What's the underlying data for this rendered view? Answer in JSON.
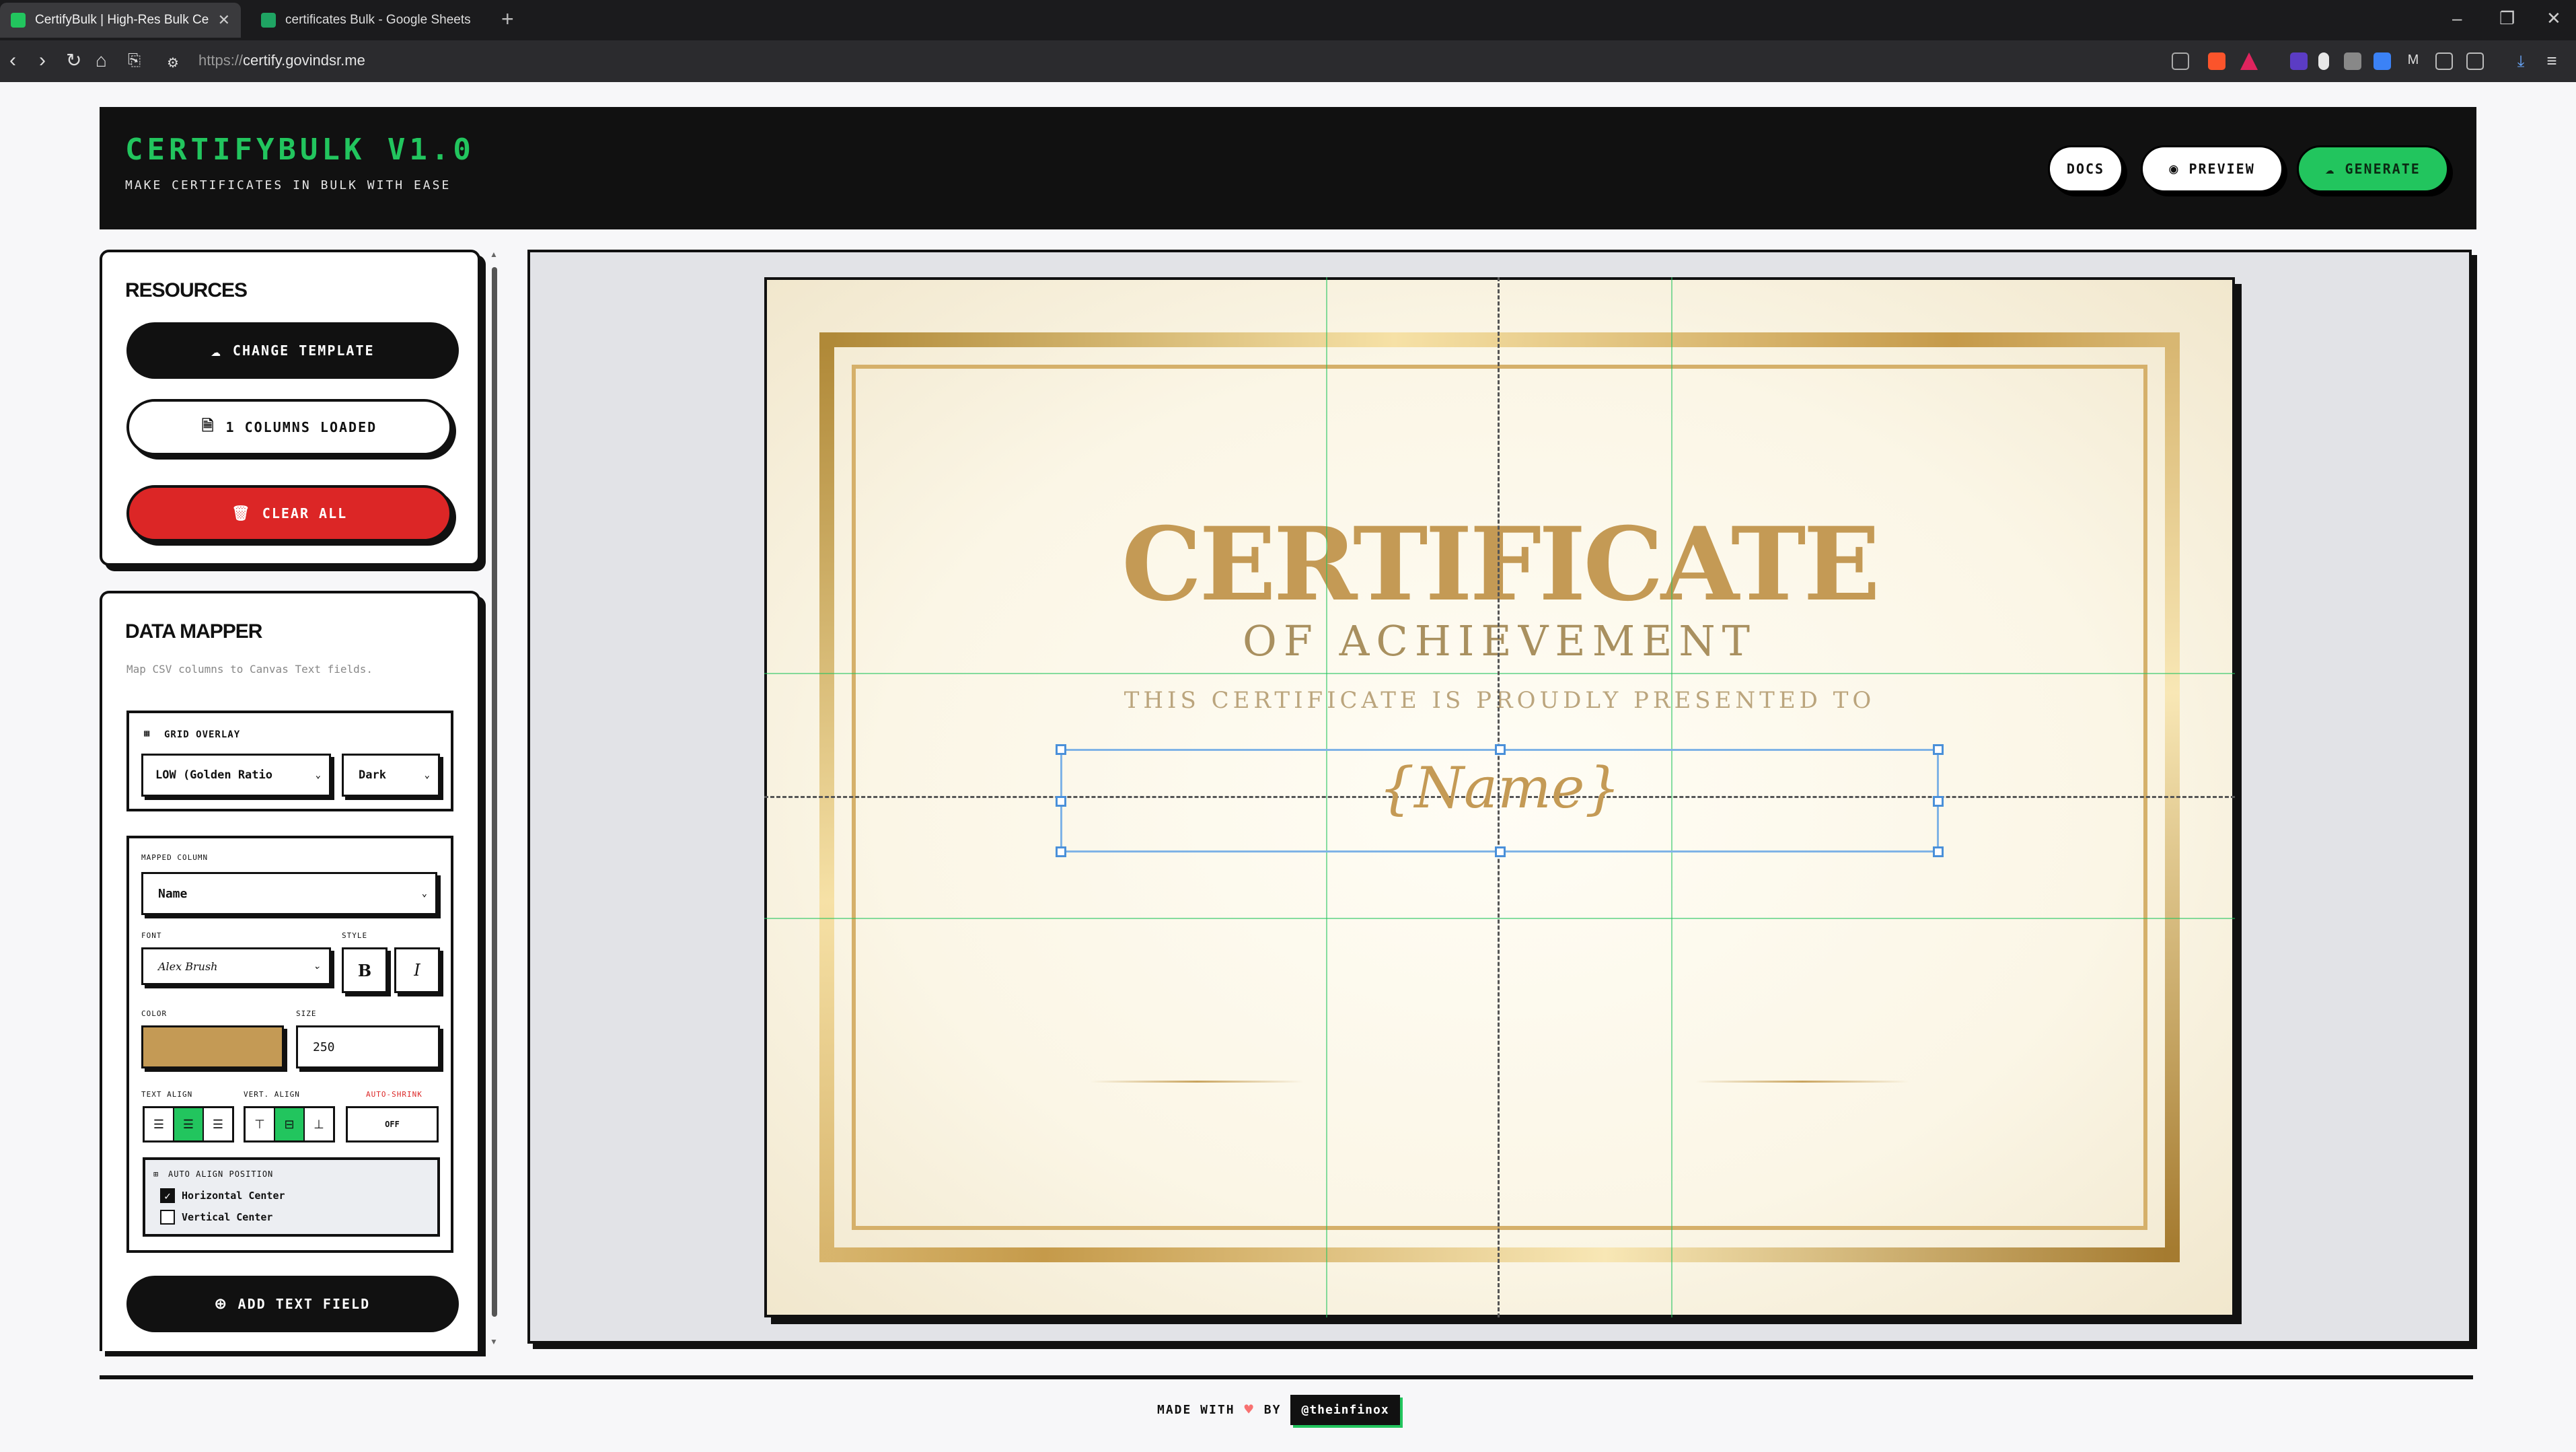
{
  "browser": {
    "tabs": [
      {
        "title": "CertifyBulk | High-Res Bulk Certifi",
        "active": true,
        "favicon_color": "#22c55e"
      },
      {
        "title": "certificates Bulk - Google Sheets",
        "active": false,
        "favicon_color": "#1fa463"
      }
    ],
    "new_tab": "+",
    "url_scheme": "https://",
    "url_host": "certify.govindsr.me",
    "window_controls": {
      "minimize": "–",
      "restore": "❐",
      "close": "✕"
    },
    "nav": {
      "back": "‹",
      "forward": "›",
      "reload": "↻",
      "home": "⌂",
      "bookmark": "⎘"
    }
  },
  "header": {
    "title": "CERTIFYBULK V1.0",
    "subtitle": "MAKE CERTIFICATES IN BULK WITH EASE",
    "buttons": {
      "docs": "DOCS",
      "preview": "PREVIEW",
      "generate": "GENERATE"
    },
    "icons": {
      "preview": "eye-icon",
      "generate": "cloud-upload-icon"
    }
  },
  "resources": {
    "title": "RESOURCES",
    "change_template": "CHANGE TEMPLATE",
    "columns_loaded": "1 COLUMNS LOADED",
    "clear_all": "CLEAR ALL"
  },
  "mapper": {
    "title": "DATA MAPPER",
    "subtitle": "Map CSV columns to Canvas Text fields.",
    "grid_overlay": {
      "label": "GRID OVERLAY",
      "mode": "LOW (Golden Ratio",
      "theme": "Dark"
    },
    "mapped_column_label": "MAPPED COLUMN",
    "mapped_column": "Name",
    "font_label": "FONT",
    "font": "Alex Brush",
    "style_label": "STYLE",
    "bold": "B",
    "italic": "I",
    "color_label": "COLOR",
    "color": "#c49a55",
    "size_label": "SIZE",
    "size": "250",
    "text_align_label": "TEXT ALIGN",
    "vert_align_label": "VERT. ALIGN",
    "auto_shrink_label": "AUTO-SHRINK",
    "auto_shrink": "OFF",
    "auto_align": {
      "label": "AUTO ALIGN POSITION",
      "horizontal": "Horizontal Center",
      "vertical": "Vertical Center",
      "horizontal_checked": true,
      "vertical_checked": false
    },
    "add_text_field": "ADD TEXT FIELD"
  },
  "certificate": {
    "title": "CERTIFICATE",
    "subtitle": "OF ACHIEVEMENT",
    "presented": "THIS CERTIFICATE IS PROUDLY PRESENTED TO",
    "placeholder": "{Name}",
    "accent_color": "#c49a55"
  },
  "footer": {
    "made_with": "MADE WITH",
    "heart": "♥",
    "by": "BY",
    "handle": "@theinfinox"
  }
}
